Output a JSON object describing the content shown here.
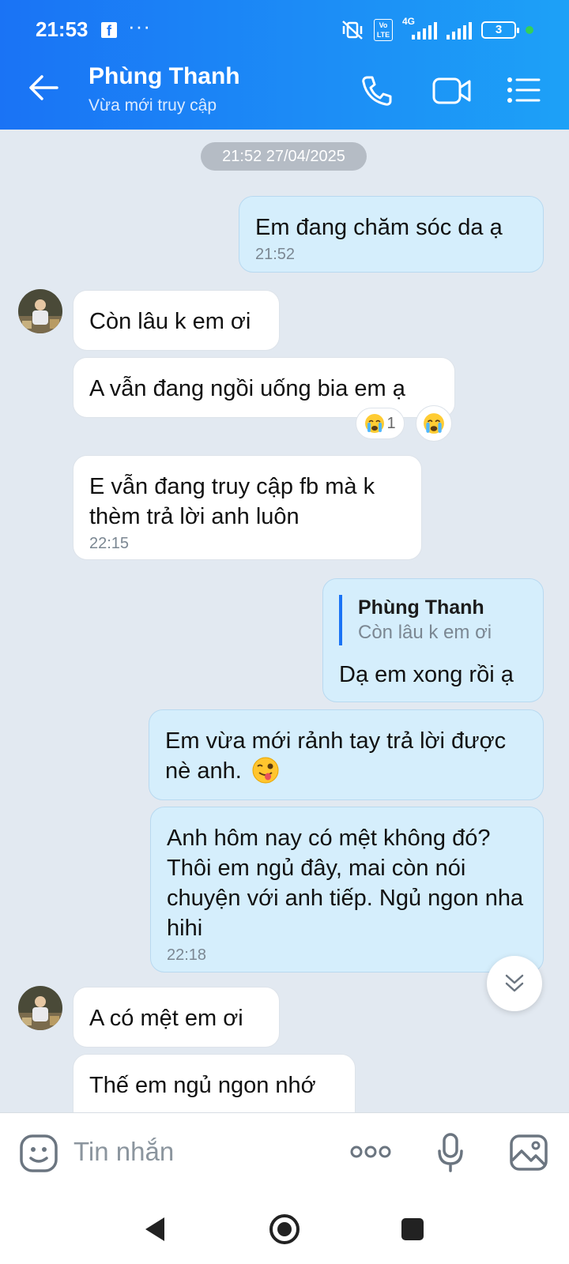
{
  "status_bar": {
    "time": "21:53",
    "fb_glyph": "f",
    "more": "···",
    "volte": "Vo LTE",
    "network": "4G",
    "battery": "3"
  },
  "header": {
    "title": "Phùng Thanh",
    "subtitle": "Vừa mới truy cập"
  },
  "chat": {
    "date_separator": "21:52 27/04/2025",
    "messages": [
      {
        "from": "me",
        "text": "Em đang chăm sóc da ạ",
        "time": "21:52"
      },
      {
        "from": "contact",
        "text": "Còn lâu k em ơi"
      },
      {
        "from": "contact",
        "text": "A vẫn đang ngồi uống bia em ạ",
        "reaction_count": "1"
      },
      {
        "from": "contact",
        "text": "E vẫn đang truy cập fb mà k thèm trả lời anh luôn",
        "time": "22:15"
      },
      {
        "from": "me",
        "quote_name": "Phùng Thanh",
        "quote_text": "Còn lâu k em ơi",
        "text": "Dạ em xong rồi ạ"
      },
      {
        "from": "me",
        "text": "Em vừa mới rảnh tay trả lời được nè anh."
      },
      {
        "from": "me",
        "text": "Anh hôm nay có mệt không đó? Thôi em ngủ đây, mai còn nói chuyện với anh tiếp. Ngủ ngon nha hihi",
        "time": "22:18"
      },
      {
        "from": "contact",
        "text": "A có mệt em ơi"
      },
      {
        "from": "contact",
        "text": "Thế em ngủ ngon nhớ"
      }
    ]
  },
  "input": {
    "placeholder": "Tin nhắn",
    "more": "ooo"
  },
  "colors": {
    "header_start": "#1a73f5",
    "header_end": "#1da1f7",
    "outgoing_bubble": "#d5eefc",
    "incoming_bubble": "#ffffff",
    "chat_bg": "#e2e9f1"
  }
}
